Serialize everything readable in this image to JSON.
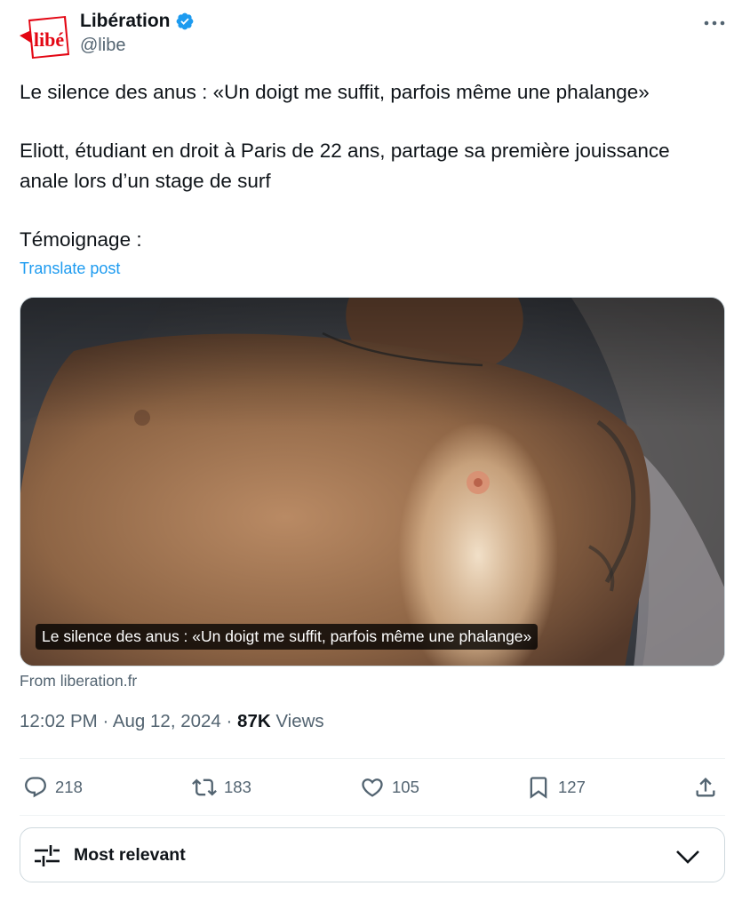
{
  "author": {
    "name": "Libération",
    "handle": "@libe",
    "avatar_text": "libé"
  },
  "post": {
    "line1": "Le silence des anus : «Un doigt me suffit, parfois même une phalange»",
    "line2": "Eliott, étudiant en droit à Paris de 22 ans, partage sa première jouissance",
    "line3": "anale lors d’un stage de surf",
    "line4": "Témoignage :",
    "translate": "Translate post"
  },
  "card": {
    "caption": "Le silence des anus : «Un doigt me suffit, parfois même une phalange»",
    "source": "From liberation.fr"
  },
  "meta": {
    "time": "12:02 PM",
    "separator": " · ",
    "date": "Aug 12, 2024",
    "views_count": "87K",
    "views_label": " Views"
  },
  "actions": {
    "replies": "218",
    "reposts": "183",
    "likes": "105",
    "bookmarks": "127"
  },
  "sort": {
    "label": "Most relevant"
  },
  "colors": {
    "accent": "#1d9bf0",
    "text": "#0f1419",
    "muted": "#536471",
    "brand": "#e30613"
  },
  "icons": [
    "verified-badge-icon",
    "more-icon",
    "reply-icon",
    "repost-icon",
    "like-icon",
    "bookmark-icon",
    "share-icon",
    "sliders-icon",
    "chevron-down-icon"
  ]
}
